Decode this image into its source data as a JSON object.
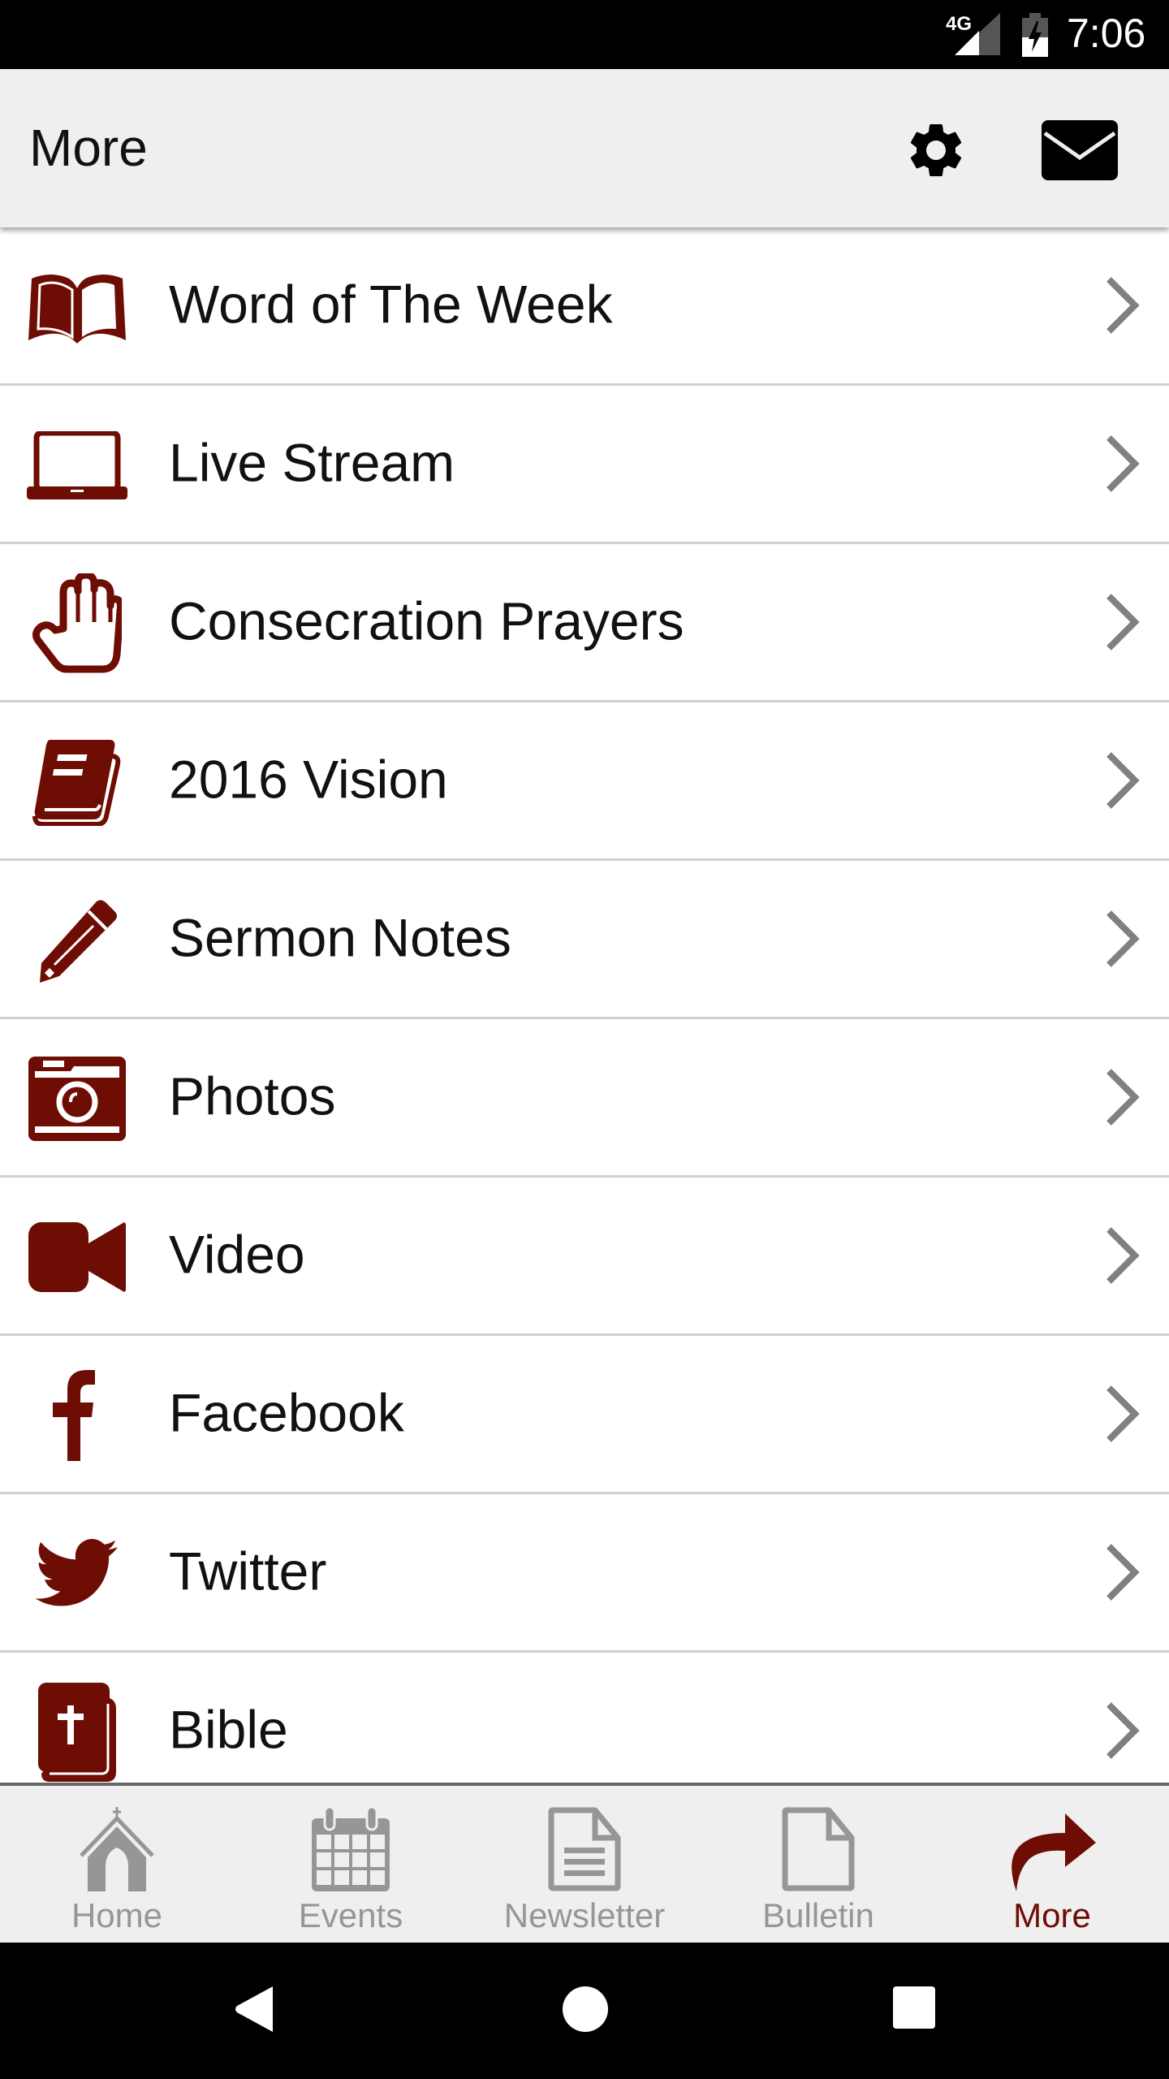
{
  "status_bar": {
    "network": "4G",
    "time": "7:06"
  },
  "app_bar": {
    "title": "More",
    "actions": [
      {
        "name": "settings",
        "icon": "gear-icon"
      },
      {
        "name": "messages",
        "icon": "envelope-icon"
      }
    ]
  },
  "menu": {
    "items": [
      {
        "label": "Word of The Week",
        "icon": "open-book-icon"
      },
      {
        "label": "Live Stream",
        "icon": "laptop-icon"
      },
      {
        "label": "Consecration Prayers",
        "icon": "hand-icon"
      },
      {
        "label": "2016 Vision",
        "icon": "book-icon"
      },
      {
        "label": "Sermon Notes",
        "icon": "pencil-icon"
      },
      {
        "label": "Photos",
        "icon": "camera-icon"
      },
      {
        "label": "Video",
        "icon": "video-camera-icon"
      },
      {
        "label": "Facebook",
        "icon": "facebook-icon"
      },
      {
        "label": "Twitter",
        "icon": "twitter-icon"
      },
      {
        "label": "Bible",
        "icon": "bible-icon"
      }
    ]
  },
  "tab_bar": {
    "tabs": [
      {
        "label": "Home",
        "icon": "church-icon",
        "active": false
      },
      {
        "label": "Events",
        "icon": "calendar-icon",
        "active": false
      },
      {
        "label": "Newsletter",
        "icon": "document-lines-icon",
        "active": false
      },
      {
        "label": "Bulletin",
        "icon": "blank-document-icon",
        "active": false
      },
      {
        "label": "More",
        "icon": "share-arrow-icon",
        "active": true
      }
    ]
  },
  "system_nav": {
    "buttons": [
      "back",
      "home",
      "recents"
    ]
  },
  "colors": {
    "accent": "#6e0d04",
    "inactive": "#969696",
    "app_bar_bg": "#efefef",
    "divider": "#d0d0d0",
    "chevron": "#808080"
  }
}
